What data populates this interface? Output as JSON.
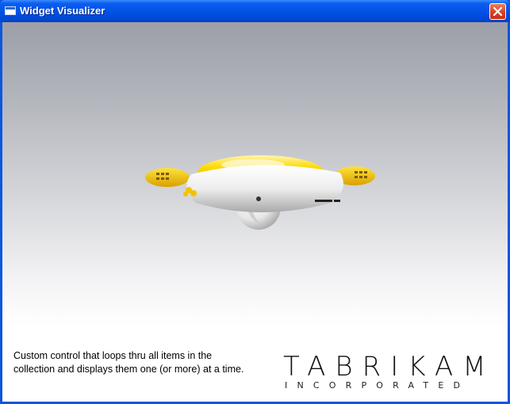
{
  "window": {
    "title": "Widget Visualizer",
    "icon": "window-icon",
    "close_icon": "close-icon"
  },
  "content": {
    "caption": "Custom control that loops thru all items in the collection and displays them one (or more) at a time.",
    "widget_image": "widget-3d-render"
  },
  "logo": {
    "wordmark": "TABRIKAM",
    "subtitle": "INCORPORATED"
  },
  "colors": {
    "titlebar": "#0052e4",
    "close_button": "#d9452a",
    "widget_yellow": "#f2c300",
    "widget_white": "#f4f4f4"
  }
}
